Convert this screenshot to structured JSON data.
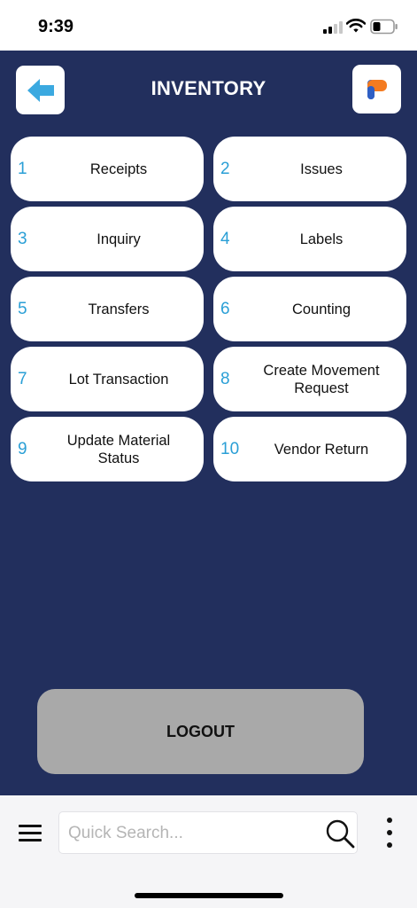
{
  "status_bar": {
    "time": "9:39"
  },
  "header": {
    "title": "INVENTORY"
  },
  "menu": [
    {
      "number": "1",
      "label": "Receipts"
    },
    {
      "number": "2",
      "label": "Issues"
    },
    {
      "number": "3",
      "label": "Inquiry"
    },
    {
      "number": "4",
      "label": "Labels"
    },
    {
      "number": "5",
      "label": "Transfers"
    },
    {
      "number": "6",
      "label": "Counting"
    },
    {
      "number": "7",
      "label": "Lot Transaction"
    },
    {
      "number": "8",
      "label": "Create Movement\nRequest"
    },
    {
      "number": "9",
      "label": "Update Material\nStatus"
    },
    {
      "number": "10",
      "label": "Vendor Return"
    }
  ],
  "logout": {
    "label": "LOGOUT"
  },
  "bottom_bar": {
    "search_placeholder": "Quick Search...",
    "search_value": ""
  },
  "icons": {
    "back": "arrow-left-icon",
    "app_logo": "app-logo-icon",
    "menu": "hamburger-menu-icon",
    "search": "search-icon",
    "more": "more-vertical-icon"
  },
  "colors": {
    "background": "#222f5d",
    "tile": "#ffffff",
    "number_accent": "#2a9fd6",
    "back_arrow": "#3ba9e0",
    "logout": "#a9a9a9",
    "logo_orange": "#f47b20",
    "logo_blue": "#2f5fc4"
  }
}
